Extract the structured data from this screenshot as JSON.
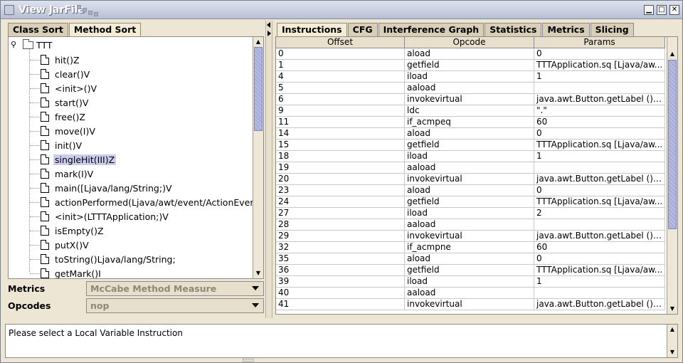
{
  "window": {
    "title": "View JarFile",
    "minimize_glyph": "▁",
    "maximize_glyph": "□",
    "close_glyph": "✕"
  },
  "left": {
    "tabs": [
      {
        "label": "Class Sort",
        "active": false
      },
      {
        "label": "Method Sort",
        "active": true
      }
    ],
    "tree": {
      "root": "TTT",
      "items": [
        "hit()Z",
        "clear()V",
        "<init>()V",
        "start()V",
        "free()Z",
        "move(I)V",
        "init()V",
        "singleHit(III)Z",
        "mark(I)V",
        "main([Ljava/lang/String;)V",
        "actionPerformed(Ljava/awt/event/ActionEvent;)V",
        "<init>(LTTTApplication;)V",
        "isEmpty()Z",
        "putX()V",
        "toString()Ljava/lang/String;",
        "getMark()I"
      ],
      "selected_index": 7
    },
    "metrics": {
      "label": "Metrics",
      "value": "McCabe Method Measure"
    },
    "opcodes": {
      "label": "Opcodes",
      "value": "nop"
    }
  },
  "right": {
    "tabs": [
      {
        "label": "Instructions",
        "active": true
      },
      {
        "label": "CFG",
        "active": false
      },
      {
        "label": "Interference Graph",
        "active": false
      },
      {
        "label": "Statistics",
        "active": false
      },
      {
        "label": "Metrics",
        "active": false
      },
      {
        "label": "Slicing",
        "active": false
      }
    ],
    "columns": [
      "Offset",
      "Opcode",
      "Params"
    ],
    "rows": [
      [
        "0",
        "aload",
        "0"
      ],
      [
        "1",
        "getfield",
        "TTTApplication.sq [Ljava/aw..."
      ],
      [
        "4",
        "iload",
        "1"
      ],
      [
        "5",
        "aaload",
        ""
      ],
      [
        "6",
        "invokevirtual",
        "java.awt.Button.getLabel ()Lj..."
      ],
      [
        "9",
        "ldc",
        "\".\""
      ],
      [
        "11",
        "if_acmpeq",
        "60"
      ],
      [
        "14",
        "aload",
        "0"
      ],
      [
        "15",
        "getfield",
        "TTTApplication.sq [Ljava/aw..."
      ],
      [
        "18",
        "iload",
        "1"
      ],
      [
        "19",
        "aaload",
        ""
      ],
      [
        "20",
        "invokevirtual",
        "java.awt.Button.getLabel ()Lj..."
      ],
      [
        "23",
        "aload",
        "0"
      ],
      [
        "24",
        "getfield",
        "TTTApplication.sq [Ljava/aw..."
      ],
      [
        "27",
        "iload",
        "2"
      ],
      [
        "28",
        "aaload",
        ""
      ],
      [
        "29",
        "invokevirtual",
        "java.awt.Button.getLabel ()Lj..."
      ],
      [
        "32",
        "if_acmpne",
        "60"
      ],
      [
        "35",
        "aload",
        "0"
      ],
      [
        "36",
        "getfield",
        "TTTApplication.sq [Ljava/aw..."
      ],
      [
        "39",
        "iload",
        "1"
      ],
      [
        "40",
        "aaload",
        ""
      ],
      [
        "41",
        "invokevirtual",
        "java.awt.Button.getLabel ()Lj..."
      ]
    ]
  },
  "status": {
    "message": "Please select a Local Variable Instruction"
  },
  "colors": {
    "selection": "#ccccee",
    "scroll_thumb": "#b9bde0",
    "panel_bg": "#eee6d4"
  }
}
